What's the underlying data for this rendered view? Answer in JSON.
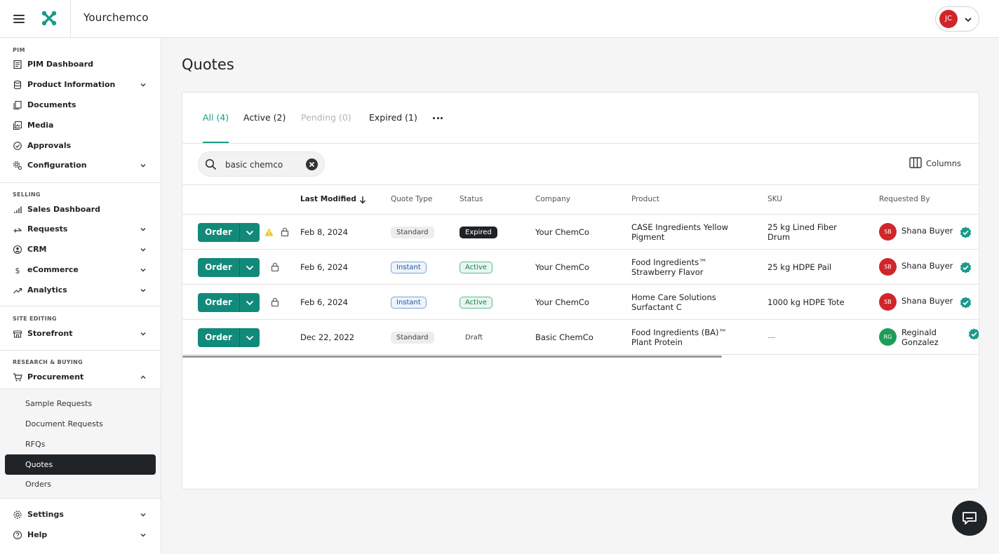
{
  "app": {
    "company_name": "Yourchemco",
    "user_initials": "JC"
  },
  "sidebar": {
    "sections": {
      "pim": "PIM",
      "selling": "SELLING",
      "site_editing": "SITE EDITING",
      "research_buying": "RESEARCH & BUYING"
    },
    "items": {
      "pim_dashboard": "PIM Dashboard",
      "product_information": "Product Information",
      "documents": "Documents",
      "media": "Media",
      "approvals": "Approvals",
      "configuration": "Configuration",
      "sales_dashboard": "Sales Dashboard",
      "requests": "Requests",
      "crm": "CRM",
      "ecommerce": "eCommerce",
      "analytics": "Analytics",
      "storefront": "Storefront",
      "procurement": "Procurement",
      "settings": "Settings",
      "help": "Help"
    },
    "procurement_sub": [
      "Sample Requests",
      "Document Requests",
      "RFQs",
      "Quotes",
      "Orders"
    ],
    "active_sub": "Quotes"
  },
  "main": {
    "title": "Quotes",
    "tabs": [
      {
        "label": "All (4)",
        "state": "active"
      },
      {
        "label": "Active (2)",
        "state": "normal"
      },
      {
        "label": "Pending (0)",
        "state": "disabled"
      },
      {
        "label": "Expired (1)",
        "state": "normal"
      }
    ],
    "search": {
      "value": "basic chemco",
      "placeholder": "Search"
    },
    "columns_label": "Columns",
    "headers": {
      "last_modified": "Last Modified",
      "quote_type": "Quote Type",
      "status": "Status",
      "company": "Company",
      "product": "Product",
      "sku": "SKU",
      "requested_by": "Requested By"
    },
    "order_label": "Order",
    "rows": [
      {
        "date": "Feb 8, 2024",
        "quote_type": "Standard",
        "status": "Expired",
        "company": "Your ChemCo",
        "product_line1": "CASE Ingredients Yellow",
        "product_line2": "Pigment",
        "sku_line1": "25 kg Lined Fiber",
        "sku_line2": "Drum",
        "initials": "SB",
        "requester_line1": "Shana Buyer",
        "requester_line2": "",
        "warning": true
      },
      {
        "date": "Feb 6, 2024",
        "quote_type": "Instant",
        "status": "Active",
        "company": "Your ChemCo",
        "product_line1": "Food Ingredients™",
        "product_line2": "Strawberry Flavor",
        "sku_line1": "25 kg HDPE Pail",
        "sku_line2": "",
        "initials": "SB",
        "requester_line1": "Shana Buyer",
        "requester_line2": "",
        "warning": false
      },
      {
        "date": "Feb 6, 2024",
        "quote_type": "Instant",
        "status": "Active",
        "company": "Your ChemCo",
        "product_line1": "Home Care Solutions",
        "product_line2": "Surfactant C",
        "sku_line1": "1000 kg HDPE Tote",
        "sku_line2": "",
        "initials": "SB",
        "requester_line1": "Shana Buyer",
        "requester_line2": "",
        "warning": false
      },
      {
        "date": "Dec 22, 2022",
        "quote_type": "Standard",
        "status": "Draft",
        "company": "Basic ChemCo",
        "product_line1": "Food Ingredients (BA)™",
        "product_line2": "Plant Protein",
        "sku_line1": "—",
        "sku_line2": "",
        "initials": "RG",
        "requester_line1": "Reginald",
        "requester_line2": "Gonzalez",
        "warning": false
      }
    ]
  },
  "colors": {
    "accent": "#1a9a8a",
    "order_button": "#128a7a",
    "avatar_sb": "#d0262b",
    "avatar_rg": "#1e9c5a",
    "verified": "#1a9a8a"
  },
  "icons": [
    "menu-icon",
    "logo-icon",
    "chevron-down-icon",
    "search-icon",
    "clear-icon",
    "columns-icon",
    "warning-icon",
    "lock-icon",
    "verified-icon",
    "chat-icon"
  ]
}
